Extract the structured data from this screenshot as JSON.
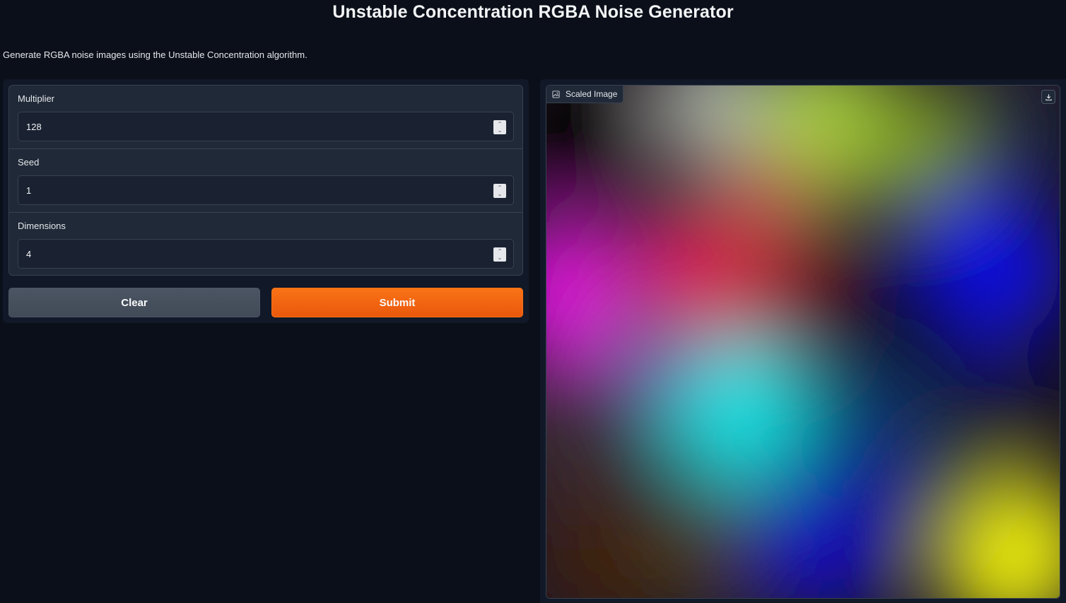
{
  "header": {
    "title": "Unstable Concentration RGBA Noise Generator",
    "description": "Generate RGBA noise images using the Unstable Concentration algorithm."
  },
  "form": {
    "fields": [
      {
        "label": "Multiplier",
        "value": "128"
      },
      {
        "label": "Seed",
        "value": "1"
      },
      {
        "label": "Dimensions",
        "value": "4"
      }
    ]
  },
  "buttons": {
    "clear_label": "Clear",
    "submit_label": "Submit"
  },
  "output": {
    "label": "Scaled Image",
    "icons": {
      "label_icon": "image-icon",
      "download_icon": "download-icon"
    }
  },
  "colors": {
    "background": "#0b0f19",
    "panel": "#111827",
    "block": "#1f2937",
    "accent": "#f97316",
    "secondary_button": "#4b5563"
  }
}
